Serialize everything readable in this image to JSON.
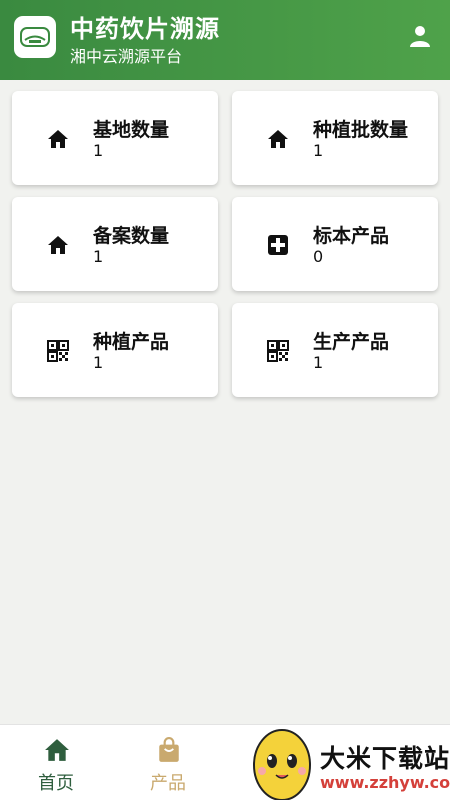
{
  "header": {
    "title": "中药饮片溯源",
    "subtitle": "湘中云溯源平台",
    "logo_icon": "logo-icon",
    "user_icon": "user-icon",
    "colors": {
      "start": "#3a8a40",
      "end": "#4fa24a"
    }
  },
  "cards": [
    {
      "label": "基地数量",
      "value": "1",
      "icon": "home-icon"
    },
    {
      "label": "种植批数量",
      "value": "1",
      "icon": "home-icon"
    },
    {
      "label": "备案数量",
      "value": "1",
      "icon": "home-icon"
    },
    {
      "label": "标本产品",
      "value": "0",
      "icon": "medical-cross-icon"
    },
    {
      "label": "种植产品",
      "value": "1",
      "icon": "qr-code-icon"
    },
    {
      "label": "生产产品",
      "value": "1",
      "icon": "qr-code-icon"
    }
  ],
  "tabbar": {
    "items": [
      {
        "label": "首页",
        "icon": "home-icon",
        "active": true,
        "color": "#2f5e3e"
      },
      {
        "label": "产品",
        "icon": "shopping-bag-icon",
        "active": false,
        "color": "#c9a96e"
      }
    ]
  },
  "watermark": {
    "text": "大米下载站",
    "url": "www.zzhyw.com"
  }
}
